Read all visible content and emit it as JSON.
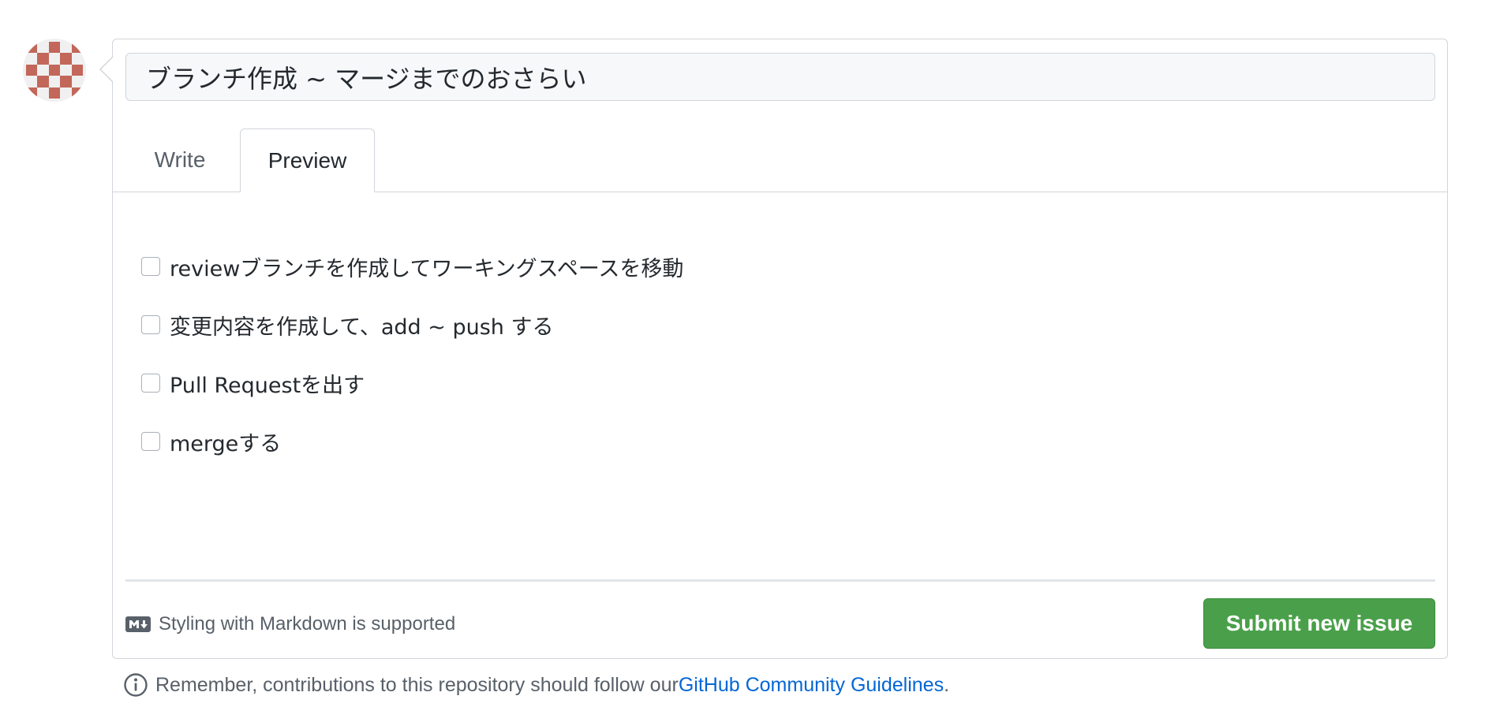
{
  "issue": {
    "title_value": "ブランチ作成 ~ マージまでのおさらい",
    "tabs": [
      {
        "label": "Write",
        "active": false
      },
      {
        "label": "Preview",
        "active": true
      }
    ],
    "tasks": [
      {
        "label": "reviewブランチを作成してワーキングスペースを移動",
        "checked": false
      },
      {
        "label": "変更内容を作成して、add ~ push する",
        "checked": false
      },
      {
        "label": "Pull Requestを出す",
        "checked": false
      },
      {
        "label": "mergeする",
        "checked": false
      }
    ],
    "markdown_note": "Styling with Markdown is supported",
    "markdown_icon": "markdown-icon",
    "submit_label": "Submit new issue"
  },
  "footer": {
    "info_icon": "info-icon",
    "text": "Remember, contributions to this repository should follow our ",
    "link_text": "GitHub Community Guidelines",
    "suffix": "."
  },
  "colors": {
    "submit_bg": "#4aa04a",
    "link": "#0366d6",
    "avatar": "#c2675a"
  }
}
